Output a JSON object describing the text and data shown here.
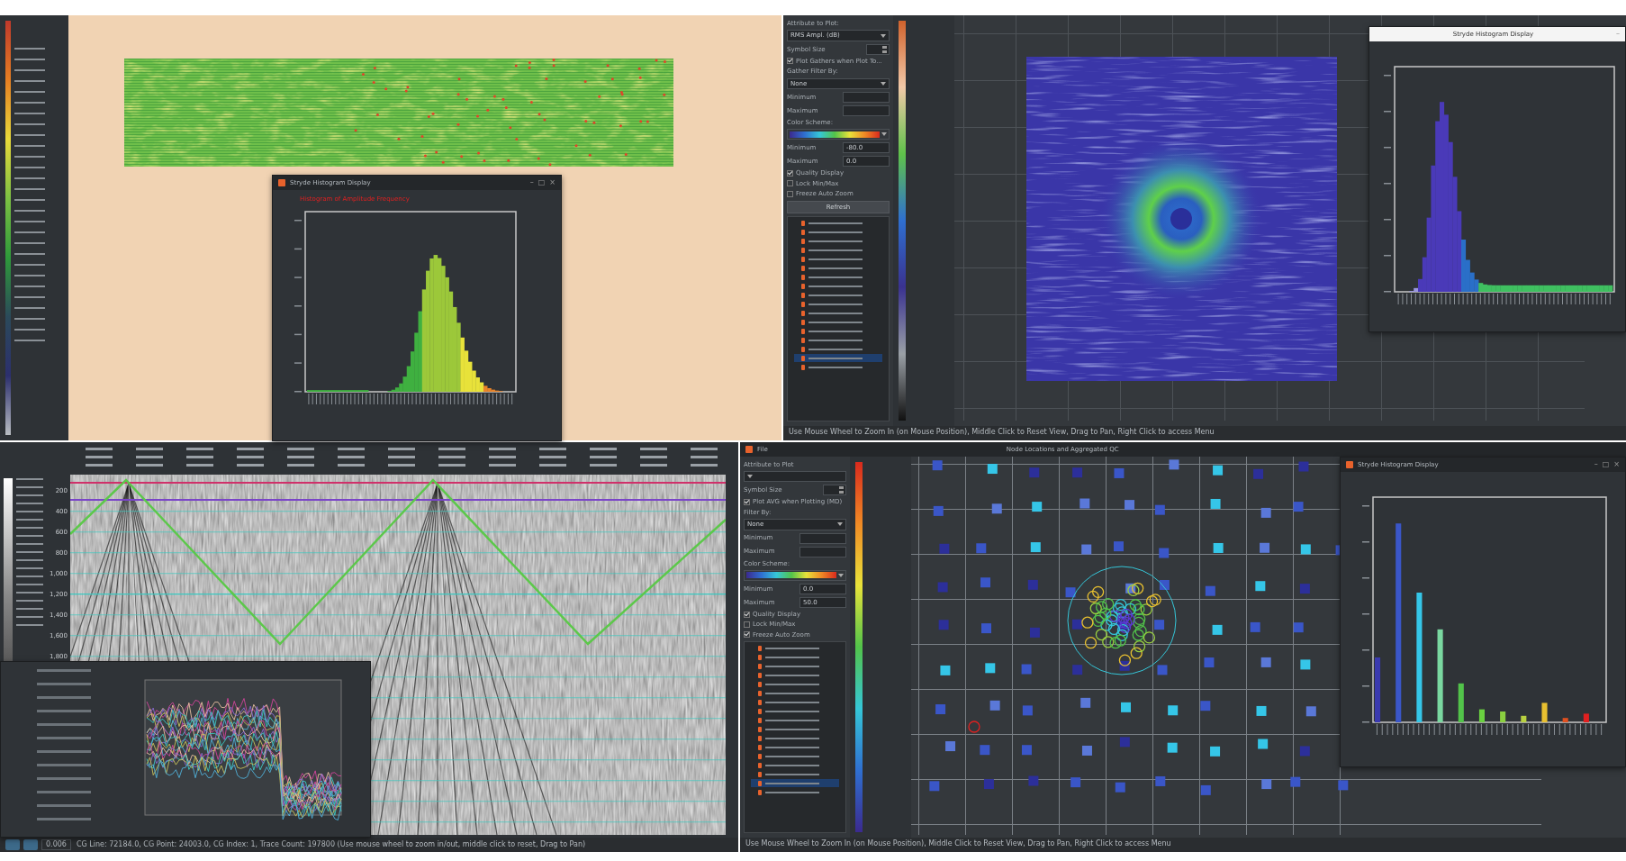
{
  "top_left": {
    "histogram_window": {
      "title": "Stryde Histogram Display",
      "window_controls": [
        "–",
        "□",
        "×"
      ],
      "chart_title": "Histogram of Amplitude Frequency"
    }
  },
  "top_right": {
    "controls": [
      {
        "kind": "label",
        "text": "Attribute to Plot:"
      },
      {
        "kind": "select",
        "text": "RMS Ampl. (dB)"
      },
      {
        "kind": "spin",
        "text": "Symbol Size"
      },
      {
        "kind": "check",
        "text": "Plot Gathers when Plot To...",
        "checked": true
      },
      {
        "kind": "label",
        "text": "Gather Filter By:"
      },
      {
        "kind": "select",
        "text": "None"
      },
      {
        "kind": "field",
        "text": "Minimum"
      },
      {
        "kind": "field",
        "text": "Maximum"
      },
      {
        "kind": "label",
        "text": "Color Scheme:"
      },
      {
        "kind": "colorscale"
      },
      {
        "kind": "field",
        "text": "Minimum",
        "value": "-80.0"
      },
      {
        "kind": "field",
        "text": "Maximum",
        "value": "0.0"
      },
      {
        "kind": "check",
        "text": "Quality Display",
        "checked": true
      },
      {
        "kind": "check",
        "text": "Lock Min/Max",
        "checked": false
      },
      {
        "kind": "check",
        "text": "Freeze Auto Zoom",
        "checked": false
      },
      {
        "kind": "button",
        "text": "Refresh"
      },
      {
        "kind": "list"
      }
    ],
    "histogram_window": {
      "title": "Stryde Histogram Display",
      "window_controls": [
        "–"
      ]
    },
    "status": "Use Mouse Wheel to Zoom In (on Mouse Position), Middle Click to Reset View, Drag to Pan, Right Click to access Menu"
  },
  "bottom_left": {
    "y_ticks": [
      "200",
      "400",
      "600",
      "800",
      "1,000",
      "1,200",
      "1,400",
      "1,600",
      "1,800"
    ],
    "status_value": "0.006",
    "status": "CG Line: 72184.0, CG Point: 24003.0, CG Index: 1, Trace Count: 197800 (Use mouse wheel to zoom in/out, middle click to reset, Drag to Pan)"
  },
  "bottom_right": {
    "menu": [
      "File"
    ],
    "title": "Node Locations and Aggregated QC",
    "controls": [
      {
        "kind": "label",
        "text": "Attribute to Plot"
      },
      {
        "kind": "select"
      },
      {
        "kind": "spin",
        "text": "Symbol Size"
      },
      {
        "kind": "check",
        "text": "Plot AVG when Plotting (MD)",
        "checked": true
      },
      {
        "kind": "label",
        "text": "Filter By:"
      },
      {
        "kind": "select",
        "text": "None"
      },
      {
        "kind": "field",
        "text": "Minimum"
      },
      {
        "kind": "field",
        "text": "Maximum"
      },
      {
        "kind": "label",
        "text": "Color Scheme:"
      },
      {
        "kind": "colorscale"
      },
      {
        "kind": "field",
        "text": "Minimum",
        "value": "0.0"
      },
      {
        "kind": "field",
        "text": "Maximum",
        "value": "50.0"
      },
      {
        "kind": "check",
        "text": "Quality Display",
        "checked": true
      },
      {
        "kind": "check",
        "text": "Lock Min/Max",
        "checked": false
      },
      {
        "kind": "check",
        "text": "Freeze Auto Zoom",
        "checked": true
      },
      {
        "kind": "list"
      }
    ],
    "histogram_window": {
      "title": "Stryde Histogram Display",
      "window_controls": [
        "–",
        "□",
        "×"
      ]
    },
    "status": "Use Mouse Wheel to Zoom In (on Mouse Position), Middle Click to Reset View, Drag to Pan, Right Click to access Menu"
  }
}
